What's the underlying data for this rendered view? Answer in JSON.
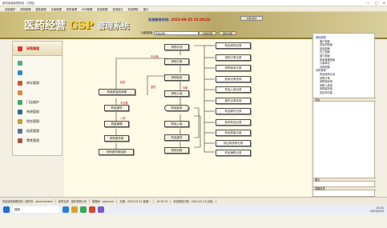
{
  "window": {
    "title": "医药经营管理系统 - [流程]",
    "controls": [
      "—",
      "□",
      "✕"
    ]
  },
  "menu": [
    "系统维护",
    "采购管理",
    "销售管理",
    "仓库管理",
    "财务管理",
    "GSP管理",
    "质量管理",
    "查询统计",
    "系统帮助",
    "窗口"
  ],
  "brand": {
    "logo_a": "医药经营",
    "logo_b": "GSP",
    "logo_c": "管理系统"
  },
  "info": {
    "label": "系统服务时间:",
    "datetime": "2023-09-25 15:30:22"
  },
  "user_button": "注销/退出",
  "search": {
    "label": "功能搜索",
    "value": "药品采购",
    "btn_a": "采购管理",
    "btn_b": "销售管理"
  },
  "nav": [
    {
      "label": "采购管理",
      "icon": "cart-icon",
      "color": "#d33"
    },
    {
      "label": "",
      "icon": "people-icon",
      "color": "#5a8"
    },
    {
      "label": "",
      "icon": "people-icon",
      "color": "#38c"
    },
    {
      "label": "库存管理",
      "icon": "box-icon",
      "color": "#c53"
    },
    {
      "label": "",
      "icon": "cart-icon",
      "color": "#d84"
    },
    {
      "label": "门店维护",
      "icon": "store-icon",
      "color": "#4a6"
    },
    {
      "label": "系统管理",
      "icon": "gear-icon",
      "color": "#369"
    },
    {
      "label": "财务管理",
      "icon": "coin-icon",
      "color": "#c93"
    },
    {
      "label": "档案管理",
      "icon": "folder-icon",
      "color": "#579"
    },
    {
      "label": "零售管理",
      "icon": "chart-icon",
      "color": "#a54"
    }
  ],
  "flow": {
    "center": [
      "采购计划",
      "采购订单",
      "采购验收",
      "采购入库",
      "药品验收",
      "药品入库",
      "药品退货",
      "采购对账"
    ],
    "left": [
      "药品质量查询表",
      "药品退货",
      "质量管理",
      "采购退货单",
      "采购退货单结算"
    ],
    "middle": [
      "采购入库单",
      "采购验收单",
      "采购退货",
      "采购退货单据"
    ],
    "right": [
      "药品采购记录",
      "采购订单记录",
      "采购验收记录",
      "验收记录查询",
      "药品入库记录",
      "退货记录查询",
      "药品养护记录",
      "库存药品记录",
      "药品质量记录",
      "供应商资质记录",
      "药品销售记录",
      "采购退货查询",
      "药品入库记录",
      "采购退货单据记录"
    ],
    "labels": [
      "不合格",
      "拒收",
      "退货",
      "合格",
      "不合格",
      "入库"
    ]
  },
  "tree": [
    "基础数据",
    "客户档案",
    "供应商档案",
    "药品档案",
    "员工档案",
    "部门档案",
    "质量管理档案",
    "计量单位",
    "仓库档案",
    "采购管理",
    "药品采购计划",
    "采购订单",
    "采购验收单",
    "采购入库单",
    "采购退货单",
    "供应商付款"
  ],
  "right_sections": [
    "消息",
    "备忘",
    "提醒事项"
  ],
  "status": [
    "药品经营管理系统 | 操作员：administrator",
    "医院名称：医药有限公司",
    "数据库：sqlserver",
    "日期：2023-09-25 星期一",
    "15:30:22",
    "系统授权日期：2024-03-27(正版)"
  ],
  "taskbar": {
    "search": "搜索",
    "time": "15:31",
    "date": "2023/9/25"
  }
}
